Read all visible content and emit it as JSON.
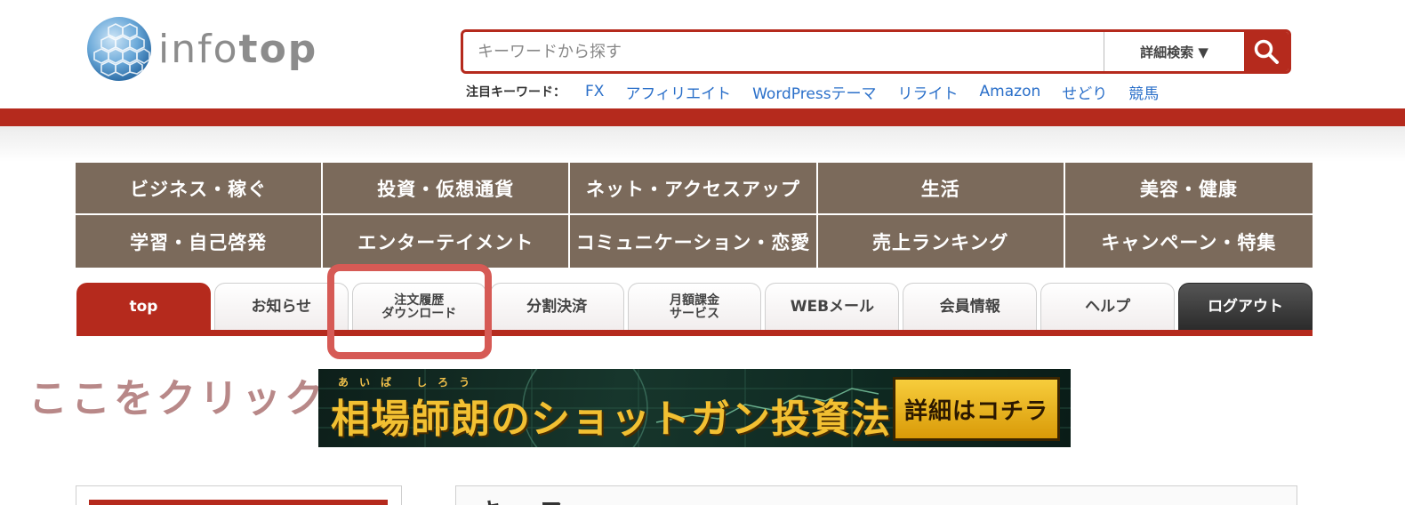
{
  "logo": {
    "prefix": "info",
    "suffix": "top"
  },
  "search": {
    "placeholder": "キーワードから探す",
    "detail_label": "詳細検索 ▼"
  },
  "keywords": {
    "label": "注目キーワード：",
    "items": [
      "FX",
      "アフィリエイト",
      "WordPressテーマ",
      "リライト",
      "Amazon",
      "せどり",
      "競馬"
    ]
  },
  "categories": [
    "ビジネス・稼ぐ",
    "投資・仮想通貨",
    "ネット・アクセスアップ",
    "生活",
    "美容・健康",
    "学習・自己啓発",
    "エンターテイメント",
    "コミュニケーション・恋愛",
    "売上ランキング",
    "キャンペーン・特集"
  ],
  "tabs": [
    {
      "line1": "top",
      "line2": ""
    },
    {
      "line1": "お知らせ",
      "line2": ""
    },
    {
      "line1": "注文履歴",
      "line2": "ダウンロード"
    },
    {
      "line1": "分割決済",
      "line2": ""
    },
    {
      "line1": "月額課金",
      "line2": "サービス"
    },
    {
      "line1": "WEBメール",
      "line2": ""
    },
    {
      "line1": "会員情報",
      "line2": ""
    },
    {
      "line1": "ヘルプ",
      "line2": ""
    },
    {
      "line1": "ログアウト",
      "line2": ""
    }
  ],
  "annotation": {
    "click_here": "ここをクリック"
  },
  "banner": {
    "ruby": "あいば しろう",
    "title": "相場師朗のショットガン投資法",
    "button": "詳細はコチラ"
  },
  "main_panel": {
    "heading_partial": "キーワ"
  },
  "colors": {
    "brand_red": "#b52a1d",
    "category_brown": "#7b6a5b",
    "link_blue": "#2a6fc9",
    "highlight": "#d65a55"
  }
}
